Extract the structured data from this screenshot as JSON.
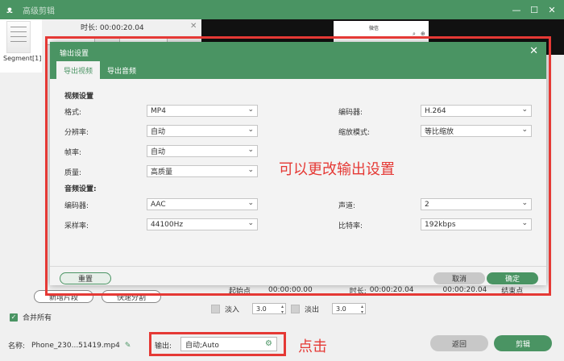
{
  "window": {
    "title": "高级剪辑",
    "logo": "app-logo-icon",
    "controls": [
      "minimize-icon",
      "maximize-icon",
      "close-icon"
    ]
  },
  "editor": {
    "segment_label": "Segment[1]",
    "duration_label": "时长:",
    "duration_value": "00:00:20.04",
    "time_row": {
      "start_label": "起始点",
      "start_value": "00:00:00.00",
      "duration_label": "时长:",
      "duration_value": "00:00:20.04",
      "end_value": "00:00:20.04",
      "end_label": "结束点"
    },
    "buttons": {
      "new_segment": "新增片段",
      "quick_split": "快速分割"
    },
    "merge_all": "合并所有",
    "merge_checked": true,
    "fade_in": {
      "label": "淡入",
      "value": "3.0"
    },
    "fade_out": {
      "label": "淡出",
      "value": "3.0"
    },
    "phone_preview_title": "微信"
  },
  "footer": {
    "name_label": "名称:",
    "filename": "Phone_230...51419.mp4",
    "output_label": "输出:",
    "output_value": "自动;Auto",
    "back_button": "返回",
    "cut_button": "剪辑"
  },
  "dialog": {
    "title": "输出设置",
    "tabs": [
      "导出视频",
      "导出音频"
    ],
    "active_tab": 0,
    "video_section": "视频设置",
    "audio_section": "音频设置:",
    "video_fields_left": [
      {
        "label": "格式:",
        "value": "MP4"
      },
      {
        "label": "分辨率:",
        "value": "自动"
      },
      {
        "label": "帧率:",
        "value": "自动"
      },
      {
        "label": "质量:",
        "value": "高质量"
      }
    ],
    "video_fields_right": [
      {
        "label": "编码器:",
        "value": "H.264"
      },
      {
        "label": "缩放模式:",
        "value": "等比缩放"
      }
    ],
    "audio_fields_left": [
      {
        "label": "编码器:",
        "value": "AAC"
      },
      {
        "label": "采样率:",
        "value": "44100Hz"
      }
    ],
    "audio_fields_right": [
      {
        "label": "声道:",
        "value": "2"
      },
      {
        "label": "比特率:",
        "value": "192kbps"
      }
    ],
    "reset_button": "重置",
    "cancel_button": "取消",
    "ok_button": "确定"
  },
  "annotations": {
    "settings_note": "可以更改输出设置",
    "click_note": "点击",
    "color": "#e53935"
  },
  "colors": {
    "brand": "#4a9463",
    "annotation": "#e53935"
  }
}
